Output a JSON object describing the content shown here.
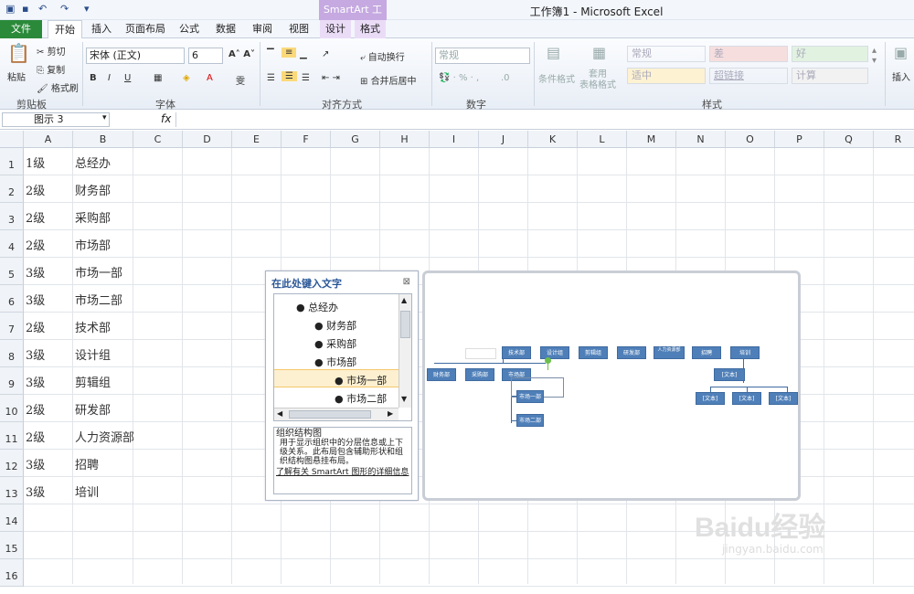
{
  "window": {
    "title": "工作簿1 - Microsoft Excel",
    "context_tab": "SmartArt 工具"
  },
  "tabs": [
    "文件",
    "开始",
    "插入",
    "页面布局",
    "公式",
    "数据",
    "审阅",
    "视图",
    "设计",
    "格式"
  ],
  "ribbon": {
    "clipboard": {
      "paste": "粘贴",
      "cut": "剪切",
      "copy": "复制",
      "format_painter": "格式刷",
      "label": "剪贴板"
    },
    "font": {
      "name": "宋体 (正文)",
      "size": "6",
      "label": "字体"
    },
    "alignment": {
      "wrap": "自动换行",
      "merge": "合并后居中",
      "label": "对齐方式"
    },
    "number": {
      "format": "常规",
      "label": "数字"
    },
    "styles": {
      "conditional": "条件格式",
      "table": "套用\n表格格式",
      "cells": [
        "常规",
        "差",
        "好",
        "适中",
        "超链接",
        "计算"
      ],
      "label": "样式"
    },
    "cells": {
      "insert": "插入"
    }
  },
  "formula_bar": {
    "name_box": "图示 3",
    "fx": "fx",
    "formula": ""
  },
  "columns": [
    "A",
    "B",
    "C",
    "D",
    "E",
    "F",
    "G",
    "H",
    "I",
    "J",
    "K",
    "L",
    "M",
    "N",
    "O",
    "P",
    "Q",
    "R"
  ],
  "rows": [
    {
      "n": "1",
      "a": "1级",
      "b": "总经办"
    },
    {
      "n": "2",
      "a": "2级",
      "b": "财务部"
    },
    {
      "n": "3",
      "a": "2级",
      "b": "采购部"
    },
    {
      "n": "4",
      "a": "2级",
      "b": "市场部"
    },
    {
      "n": "5",
      "a": "3级",
      "b": "市场一部"
    },
    {
      "n": "6",
      "a": "3级",
      "b": "市场二部"
    },
    {
      "n": "7",
      "a": "2级",
      "b": "技术部"
    },
    {
      "n": "8",
      "a": "3级",
      "b": "设计组"
    },
    {
      "n": "9",
      "a": "3级",
      "b": "剪辑组"
    },
    {
      "n": "10",
      "a": "2级",
      "b": "研发部"
    },
    {
      "n": "11",
      "a": "2级",
      "b": "人力资源部"
    },
    {
      "n": "12",
      "a": "3级",
      "b": "招聘"
    },
    {
      "n": "13",
      "a": "3级",
      "b": "培训"
    },
    {
      "n": "14",
      "a": "",
      "b": ""
    },
    {
      "n": "15",
      "a": "",
      "b": ""
    },
    {
      "n": "16",
      "a": "",
      "b": ""
    }
  ],
  "text_pane": {
    "title": "在此处键入文字",
    "items": [
      "总经办",
      "财务部",
      "采购部",
      "市场部",
      "市场一部",
      "市场二部"
    ],
    "desc_title": "组织结构图",
    "desc_body": "用于显示组织中的分层信息或上下级关系。此布局包含辅助形状和组织结构图悬挂布局。",
    "link": "了解有关 SmartArt 图形的详细信息"
  },
  "smartart": {
    "top_nodes": [
      "技术部",
      "设计组",
      "剪辑组",
      "研发部",
      "人力资源部",
      "招聘",
      "培训"
    ],
    "second_nodes": [
      "财务部",
      "采购部",
      "市场部"
    ],
    "sub_nodes": [
      "市场一部",
      "市场二部"
    ],
    "text_nodes": [
      "[文本]",
      "[文本]",
      "[文本]",
      "[文本]"
    ]
  },
  "watermark": {
    "brand": "Baidu经验",
    "url": "jingyan.baidu.com"
  }
}
